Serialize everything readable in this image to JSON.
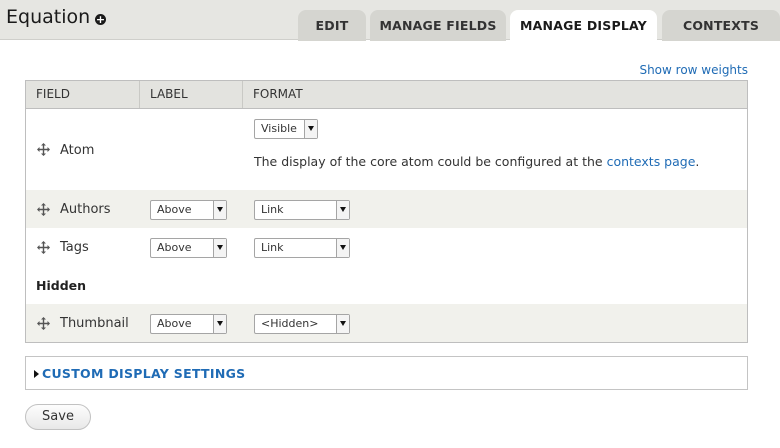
{
  "header": {
    "title": "Equation",
    "add_icon": "plus-circle-icon",
    "tabs": [
      {
        "label": "EDIT",
        "active": false
      },
      {
        "label": "MANAGE FIELDS",
        "active": false
      },
      {
        "label": "MANAGE DISPLAY",
        "active": true
      },
      {
        "label": "CONTEXTS",
        "active": false
      }
    ]
  },
  "row_weights_link": "Show row weights",
  "table": {
    "headers": [
      "FIELD",
      "LABEL",
      "FORMAT"
    ],
    "rows": [
      {
        "field": "Atom",
        "label_value": "",
        "format_value": "Visible",
        "note_prefix": "The display of the core atom could be configured at the ",
        "note_link": "contexts page",
        "note_suffix": "."
      },
      {
        "field": "Authors",
        "label_value": "Above",
        "format_value": "Link"
      },
      {
        "field": "Tags",
        "label_value": "Above",
        "format_value": "Link"
      }
    ],
    "hidden_heading": "Hidden",
    "hidden_rows": [
      {
        "field": "Thumbnail",
        "label_value": "Above",
        "format_value": "<Hidden>"
      }
    ]
  },
  "custom_settings_label": "CUSTOM DISPLAY SETTINGS",
  "save_label": "Save",
  "colors": {
    "link": "#1f6bb5",
    "header_bg": "#e6e6e2",
    "tab_bg": "#d5d5d0"
  }
}
